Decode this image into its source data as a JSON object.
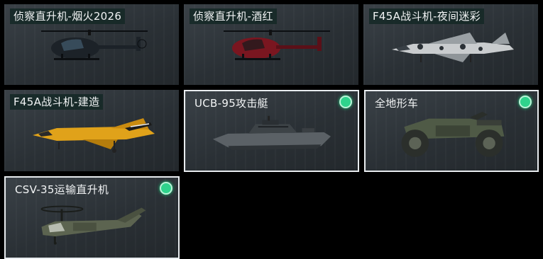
{
  "items": [
    {
      "name": "侦察直升机-烟火2026",
      "selected": false,
      "owned": false
    },
    {
      "name": "侦察直升机-酒红",
      "selected": false,
      "owned": false
    },
    {
      "name": "F45A战斗机-夜间迷彩",
      "selected": false,
      "owned": false
    },
    {
      "name": "F45A战斗机-建造",
      "selected": false,
      "owned": false
    },
    {
      "name": "UCB-95攻击艇",
      "selected": true,
      "owned": true
    },
    {
      "name": "全地形车",
      "selected": true,
      "owned": true
    },
    {
      "name": "CSV-35运输直升机",
      "selected": true,
      "owned": true
    }
  ],
  "colors": {
    "owned_dot": "#2fd38c",
    "heli_smoke": "#1c2228",
    "heli_red": "#7a1620",
    "jet_camo": "#c9ccce",
    "jet_yellow": "#e0a21a",
    "boat": "#5b6166",
    "atv": "#4f5a46",
    "transport": "#5c6450"
  }
}
